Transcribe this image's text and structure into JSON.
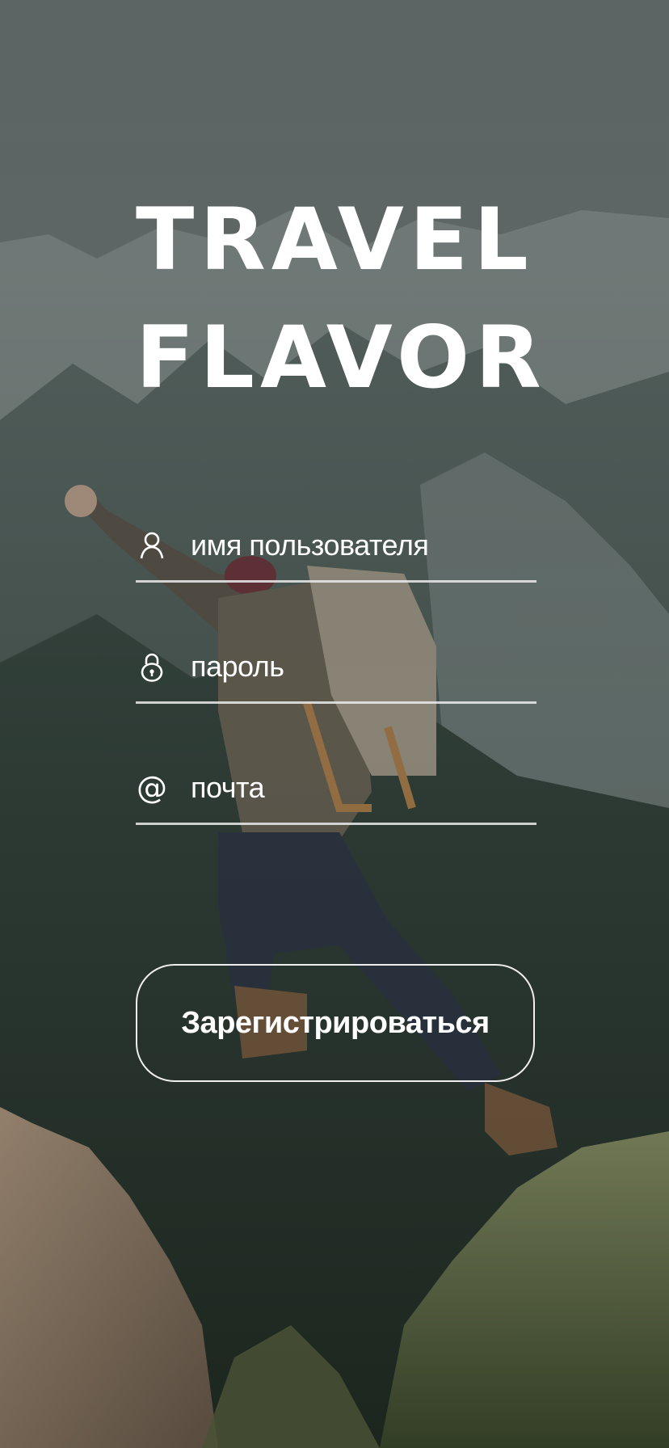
{
  "app": {
    "logo_line1": "TRAVEL",
    "logo_line2": "FLAVOR"
  },
  "form": {
    "fields": [
      {
        "icon": "user-icon",
        "placeholder": "имя пользователя"
      },
      {
        "icon": "lock-icon",
        "placeholder": "пароль"
      },
      {
        "icon": "at-icon",
        "placeholder": "почта",
        "icon_glyph": "@"
      }
    ],
    "register_label": "Зарегистрироваться"
  },
  "colors": {
    "text": "#ffffff",
    "underline": "#e6e6e6",
    "background_tint": "#4e5a57"
  }
}
